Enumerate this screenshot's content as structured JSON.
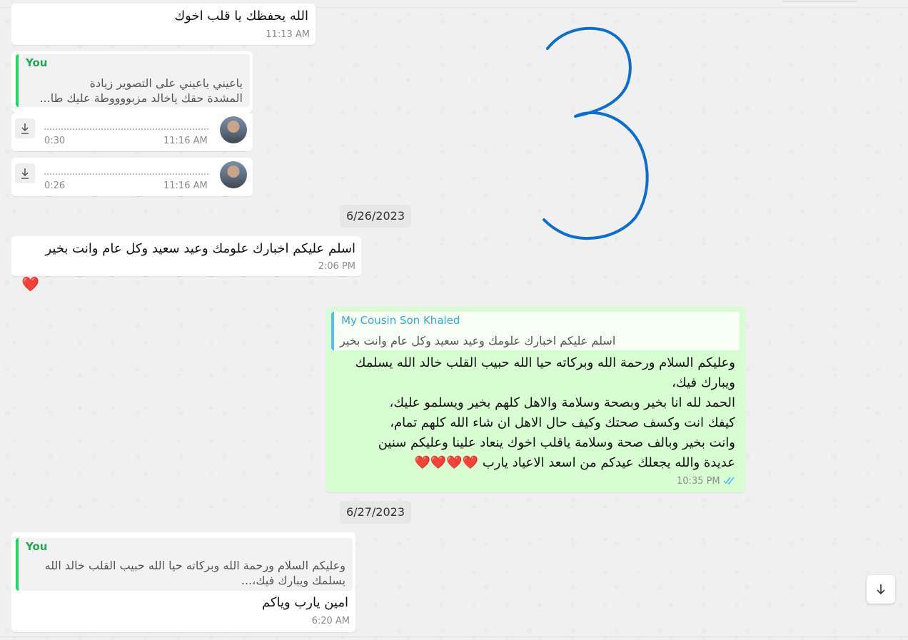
{
  "messages": {
    "m1": {
      "text": "الله يحفظك  يا قلب اخوك",
      "time": "11:13 AM"
    },
    "m2": {
      "quote_name": "You",
      "quote_line1": "ياعيني ياعيني على التصوير زيادة",
      "quote_line2": "المشدة حقك ياخالد مزبووووطة عليك طا..."
    },
    "voice1": {
      "duration": "0:30",
      "time": "11:16 AM"
    },
    "voice2": {
      "duration": "0:26",
      "time": "11:16 AM"
    },
    "m3": {
      "text": "اسلم عليكم اخبارك علومك وعيد سعيد وكل عام وانت بخير",
      "time": "2:06 PM",
      "reaction": "❤️"
    },
    "m4": {
      "quote_name": "My Cousin Son Khaled",
      "quote_text": "اسلم عليكم اخبارك علومك وعيد سعيد وكل عام وانت بخير",
      "lines": [
        "وعليكم السلام ورحمة الله وبركاته حيا الله حبيب القلب خالد الله يسلمك",
        "ويبارك فيك،",
        "الحمد لله انا بخير وبصحة وسلامة والاهل كلهم بخير ويسلمو عليك،",
        "كيفك انت وكسف صحتك وكيف حال الاهل ان شاء الله كلهم تمام،",
        "وانت بخير وبالف صحة وسلامة ياقلب اخوك ينعاد علينا وعليكم سنين",
        "عديدة والله يجعلك عيدكم من اسعد الاعياد يارب ❤️❤️❤️❤️"
      ],
      "time": "10:35 PM"
    },
    "m5": {
      "quote_name": "You",
      "quote_line1": "وعليكم السلام ورحمة الله وبركاته حيا الله حبيب القلب خالد الله",
      "quote_line2": "يسلمك ويبارك فيك،...",
      "text": "امين يارب وياكم",
      "time": "6:20 AM"
    }
  },
  "dates": {
    "d1": "6/26/2023",
    "d2": "6/27/2023"
  },
  "colors": {
    "outgoing": "#d9fdd3",
    "ink": "#0b6fd1",
    "read_ticks": "#53bdeb"
  }
}
